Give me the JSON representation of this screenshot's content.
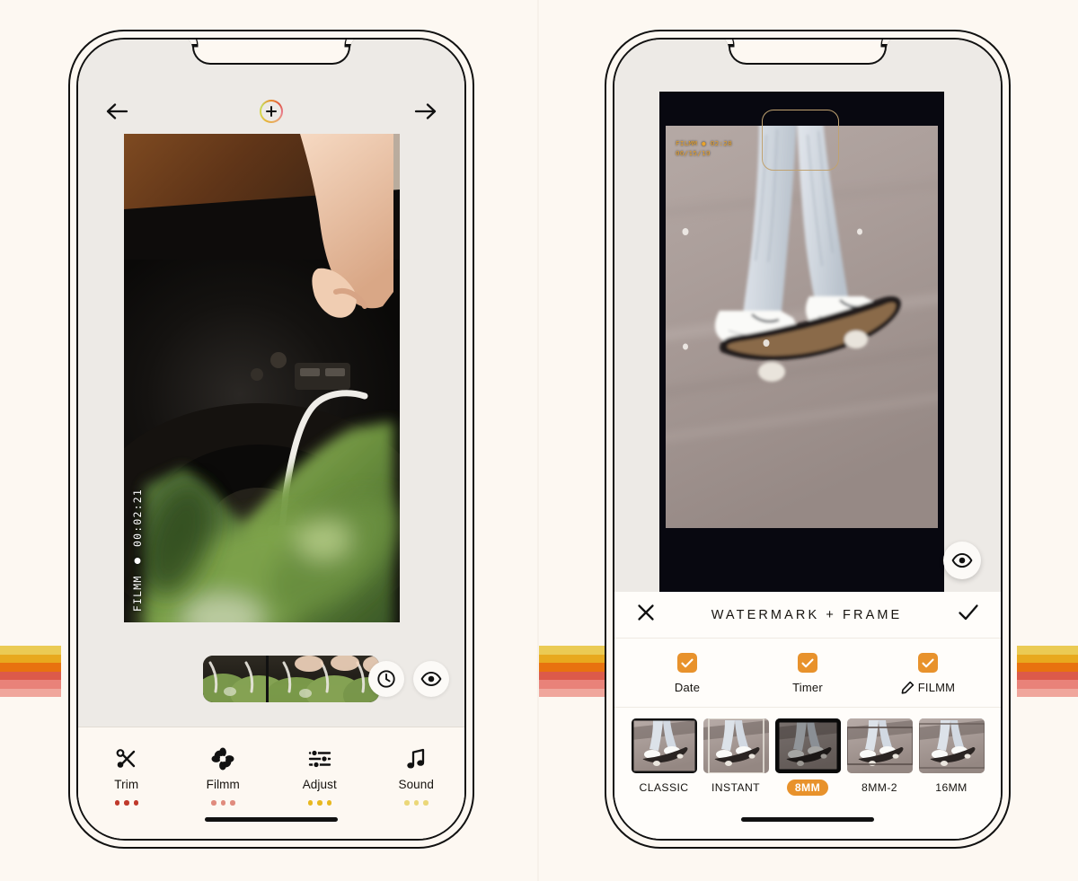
{
  "page": {
    "background_color": "#FDF8F2",
    "accent_orange": "#E8922C"
  },
  "stripes": {
    "colors": [
      "#EBCB54",
      "#E8A91E",
      "#E8720F",
      "#DC5A4A",
      "#E98279",
      "#F0A69C"
    ]
  },
  "left_phone": {
    "topbar": {
      "back_icon": "arrow-left-icon",
      "add_icon": "plus-circle-icon",
      "forward_icon": "arrow-right-icon"
    },
    "video": {
      "watermark_text": "FILMM ● 00:02:21",
      "alt": "hand-lifting-turntable-tonearm"
    },
    "timeline": {
      "clock_icon": "clock-icon",
      "eye_icon": "eye-icon",
      "playhead_position_pct": 36
    },
    "toolbar": [
      {
        "label": "Trim",
        "icon": "scissors-icon",
        "dot_color": "#C0392B"
      },
      {
        "label": "Filmm",
        "icon": "flower-icon",
        "dot_color": "#E08B7E"
      },
      {
        "label": "Adjust",
        "icon": "sliders-icon",
        "dot_color": "#E8B820"
      },
      {
        "label": "Sound",
        "icon": "music-note-icon",
        "dot_color": "#EBD778"
      }
    ]
  },
  "right_phone": {
    "video": {
      "watermark_line1": "FILMM ● 02:28",
      "watermark_line2": "06/15/19",
      "watermark_color": "#E8A32C",
      "frame_border_color": "#C0A270",
      "alt": "person-skateboarding"
    },
    "eye_fab_icon": "eye-icon",
    "sheet": {
      "close_icon": "close-icon",
      "title": "WATERMARK + FRAME",
      "confirm_icon": "check-icon",
      "options": [
        {
          "label": "Date",
          "checked": true,
          "icon": null
        },
        {
          "label": "Timer",
          "checked": true,
          "icon": null
        },
        {
          "label": "FILMM",
          "checked": true,
          "icon": "pencil-icon"
        }
      ],
      "filters": [
        {
          "name": "CLASSIC",
          "selected": false
        },
        {
          "name": "INSTANT",
          "selected": false
        },
        {
          "name": "8MM",
          "selected": true
        },
        {
          "name": "8MM-2",
          "selected": false
        },
        {
          "name": "16MM",
          "selected": false
        }
      ]
    }
  }
}
